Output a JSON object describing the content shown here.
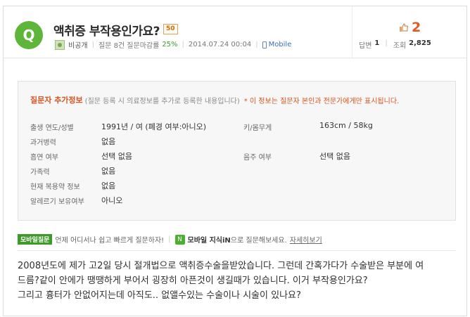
{
  "question": {
    "badge_letter": "Q",
    "title": "액취증 부작용인가요?",
    "points": "50",
    "user": "비공개",
    "stats_prefix": "질문 8건 질문마감률",
    "close_rate": "25%",
    "datetime": "2014.07.24 00:04",
    "device": "Mobile"
  },
  "side": {
    "vote_count": "2",
    "answers_label": "답변",
    "answers_value": "1",
    "views_label": "조회",
    "views_value": "2,825"
  },
  "info": {
    "title": "질문자 추가정보",
    "subtitle": "(질문 등록 시 의료정보를 추가로 등록한 내용입니다)",
    "warning": "* 이 정보는 질문자 본인과 전문가에게만 표시됩니다.",
    "rows": [
      {
        "label": "출생 연도/성별",
        "value": "1991년 / 여 (폐경 여부:아니오)"
      },
      {
        "label": "과거병력",
        "value": "없음"
      },
      {
        "label": "흡연 여부",
        "value": "선택 없음"
      },
      {
        "label": "가족력",
        "value": "없음"
      },
      {
        "label": "현재 복용약 정보",
        "value": "없음"
      },
      {
        "label": "알레르기 보유여부",
        "value": "아니오"
      }
    ],
    "right_rows": [
      {
        "label": "키/몸무게",
        "value": "163cm / 58kg"
      },
      {
        "label": "음주 여부",
        "value": "선택 없음"
      }
    ]
  },
  "mobile": {
    "badge": "모바일질문",
    "text": "언제 어디서나 쉽고 빠르게 질문하자!",
    "brand": "모바일 지식iN",
    "text2": "으로 질문해보세요.",
    "link": "자세히보기"
  },
  "body": {
    "line1": "2008년도에 제가 고2일 당시 절개법으로 액취증수술을받았습니다. 그런데 간혹가다가 수술받은 부분에 여",
    "line2": "드름?같이 안에가 땡땡하게 부어서 굉장히 아픈것이 생길때가 있습니다. 이거 부작용인가요?",
    "line3": "그리고 흉터가 안없어지는데 아직도.. 없앨수있는 수술이나 시술이 있나요?"
  }
}
